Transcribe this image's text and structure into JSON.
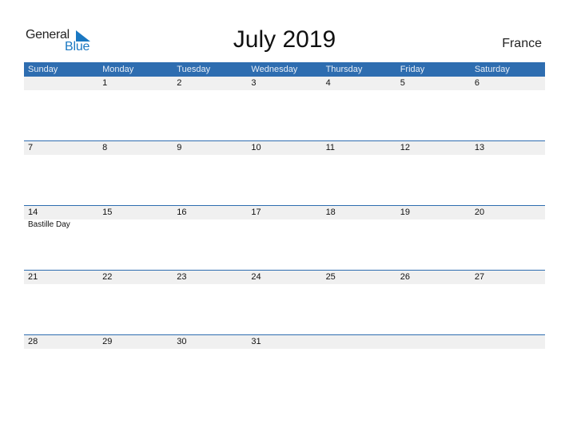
{
  "logo": {
    "line1": "General",
    "line2": "Blue"
  },
  "title": "July 2019",
  "country": "France",
  "colors": {
    "accent": "#2e6db0",
    "strip": "#f0f0f0",
    "logo_blue": "#1a78c2"
  },
  "weekdays": [
    "Sunday",
    "Monday",
    "Tuesday",
    "Wednesday",
    "Thursday",
    "Friday",
    "Saturday"
  ],
  "weeks": [
    {
      "days": [
        "",
        "1",
        "2",
        "3",
        "4",
        "5",
        "6"
      ],
      "events": [
        "",
        "",
        "",
        "",
        "",
        "",
        ""
      ]
    },
    {
      "days": [
        "7",
        "8",
        "9",
        "10",
        "11",
        "12",
        "13"
      ],
      "events": [
        "",
        "",
        "",
        "",
        "",
        "",
        ""
      ]
    },
    {
      "days": [
        "14",
        "15",
        "16",
        "17",
        "18",
        "19",
        "20"
      ],
      "events": [
        "Bastille Day",
        "",
        "",
        "",
        "",
        "",
        ""
      ]
    },
    {
      "days": [
        "21",
        "22",
        "23",
        "24",
        "25",
        "26",
        "27"
      ],
      "events": [
        "",
        "",
        "",
        "",
        "",
        "",
        ""
      ]
    },
    {
      "days": [
        "28",
        "29",
        "30",
        "31",
        "",
        "",
        ""
      ],
      "events": [
        "",
        "",
        "",
        "",
        "",
        "",
        ""
      ]
    }
  ]
}
